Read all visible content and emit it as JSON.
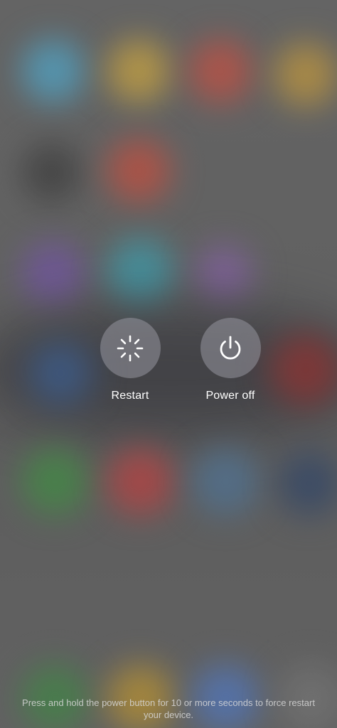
{
  "power_menu": {
    "restart": {
      "label": "Restart",
      "icon": "restart-spinner-icon"
    },
    "power_off": {
      "label": "Power off",
      "icon": "power-icon"
    }
  },
  "hint": {
    "text": "Press and hold the power button for 10 or more seconds to force restart your device."
  },
  "colors": {
    "button_background": "#9a9aa0",
    "label": "#ffffff",
    "hint": "#d8d8d8"
  }
}
